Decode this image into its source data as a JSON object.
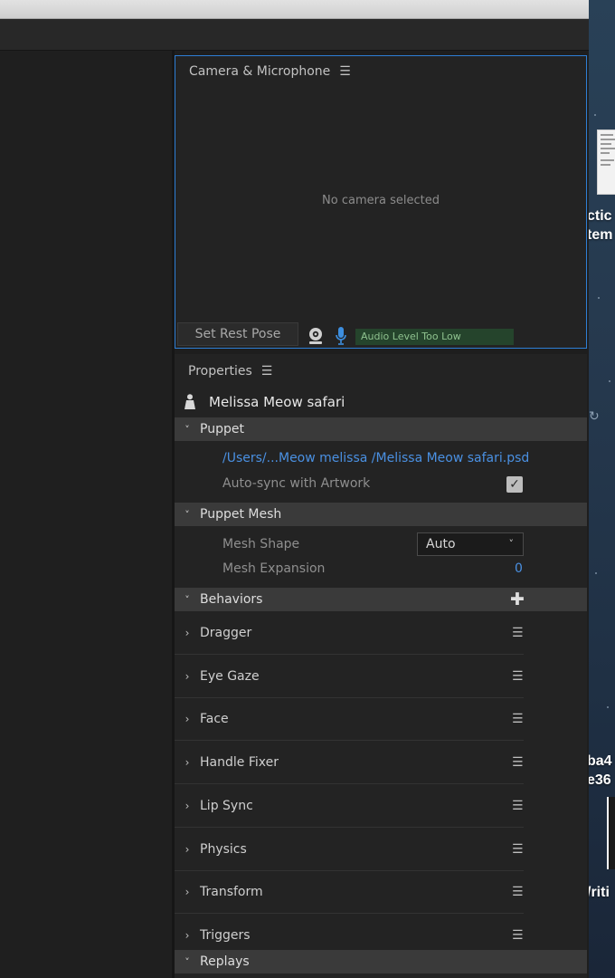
{
  "camera": {
    "title": "Camera & Microphone",
    "status": "No camera selected",
    "rest_pose_label": "Set Rest Pose",
    "audio_status": "Audio Level Too Low"
  },
  "properties": {
    "title": "Properties",
    "puppet_name": "Melissa Meow  safari",
    "sections": {
      "puppet": "Puppet",
      "puppet_mesh": "Puppet Mesh",
      "behaviors": "Behaviors",
      "replays": "Replays"
    },
    "puppet": {
      "path": "/Users/...Meow melissa /Melissa Meow  safari.psd",
      "autosync_label": "Auto-sync with Artwork",
      "autosync_checked": true
    },
    "mesh": {
      "shape_label": "Mesh Shape",
      "shape_value": "Auto",
      "expansion_label": "Mesh Expansion",
      "expansion_value": "0"
    },
    "behaviors": [
      "Dragger",
      "Eye Gaze",
      "Face",
      "Handle Fixer",
      "Lip Sync",
      "Physics",
      "Transform",
      "Triggers"
    ]
  },
  "desktop": {
    "labels": [
      "ctic",
      "tem",
      "ba4",
      "e36",
      "/riti"
    ]
  },
  "colors": {
    "accent": "#2e7fd6",
    "link": "#4a90e2",
    "audio_meter": "#25442c"
  }
}
